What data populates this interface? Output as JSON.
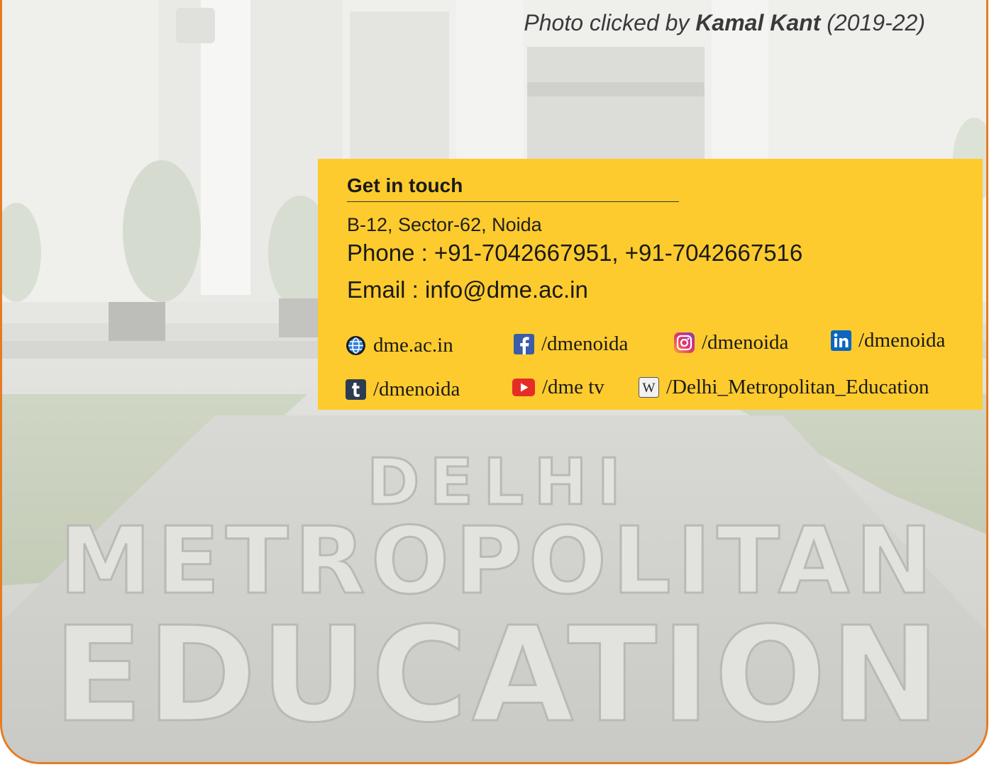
{
  "photo_credit": {
    "prefix": "Photo clicked by ",
    "name": "Kamal Kant",
    "suffix": " (2019-22)"
  },
  "contact": {
    "heading": "Get in touch",
    "address": "B-12, Sector-62, Noida",
    "phone": "Phone : +91-7042667951, +91-7042667516",
    "email": "Email : info@dme.ac.in"
  },
  "social": {
    "website": {
      "icon": "globe-icon",
      "label": "dme.ac.in"
    },
    "facebook": {
      "icon": "facebook-icon",
      "label": "/dmenoida"
    },
    "instagram": {
      "icon": "instagram-icon",
      "label": "/dmenoida"
    },
    "linkedin": {
      "icon": "linkedin-icon",
      "label": "/dmenoida"
    },
    "tumblr": {
      "icon": "tumblr-icon",
      "label": "/dmenoida"
    },
    "youtube": {
      "icon": "youtube-icon",
      "label": "/dme tv"
    },
    "wikipedia": {
      "icon": "wikipedia-icon",
      "label": "/Delhi_Metropolitan_Education"
    }
  },
  "background_photo": {
    "engraved_text": [
      "DELHI",
      "METROPOLITAN",
      "EDUCATION"
    ]
  },
  "colors": {
    "frame_border": "#e57c25",
    "panel": "#fecb2e",
    "text": "#1a1a1a"
  }
}
